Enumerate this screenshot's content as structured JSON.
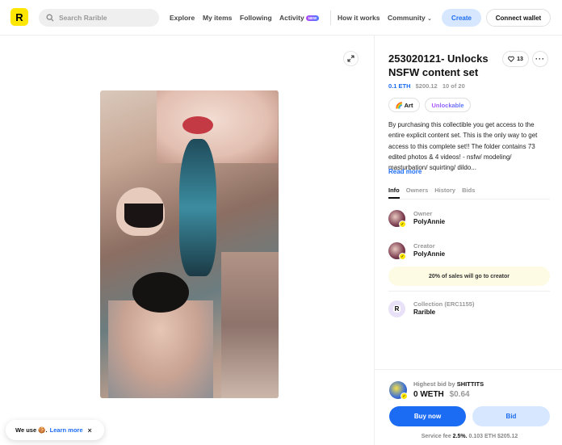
{
  "header": {
    "logo": "R",
    "search_placeholder": "Search Rarible",
    "nav": {
      "explore": "Explore",
      "my_items": "My items",
      "following": "Following",
      "activity": "Activity",
      "activity_badge": "NEW",
      "how_it_works": "How it works",
      "community": "Community"
    },
    "create": "Create",
    "connect_wallet": "Connect wallet"
  },
  "item": {
    "title": "253020121- Unlocks NSFW content set",
    "likes": "13",
    "more": "···",
    "price_eth": "0.1 ETH",
    "price_usd": "$200.12",
    "edition": "10 of 20",
    "tags": {
      "art": "🌈 Art",
      "unlockable": "Unlockable"
    },
    "description": "By purchasing this collectible you get access to the entire explicit content set.  This is the only way to get access to this complete set!! The folder contains 73 edited photos & 4 videos! - nsfw/ modeling/ masturbation/ squirting/ dildo...",
    "read_more": "Read more",
    "tabs": [
      "Info",
      "Owners",
      "History",
      "Bids"
    ],
    "owner": {
      "role": "Owner",
      "name": "PolyAnnie"
    },
    "creator": {
      "role": "Creator",
      "name": "PolyAnnie"
    },
    "royalty": "20% of sales will go to creator",
    "collection": {
      "role": "Collection (ERC1155)",
      "name": "Rarible",
      "avatar": "R"
    }
  },
  "bid": {
    "label_prefix": "Highest bid by",
    "bidder": "SHITTITS",
    "amount": "0 WETH",
    "amount_usd": "$0.64",
    "buy_now": "Buy now",
    "bid": "Bid",
    "service_prefix": "Service fee",
    "service_pct": "2.5%.",
    "service_rest": "0.103 ETH  $205.12"
  },
  "toast": {
    "text": "We use 🍪.",
    "learn_more": "Learn more",
    "close": "×"
  },
  "colors": {
    "brand_yellow": "#fee603",
    "accent_blue": "#1c6cf3",
    "light_blue": "#d6e7ff"
  }
}
